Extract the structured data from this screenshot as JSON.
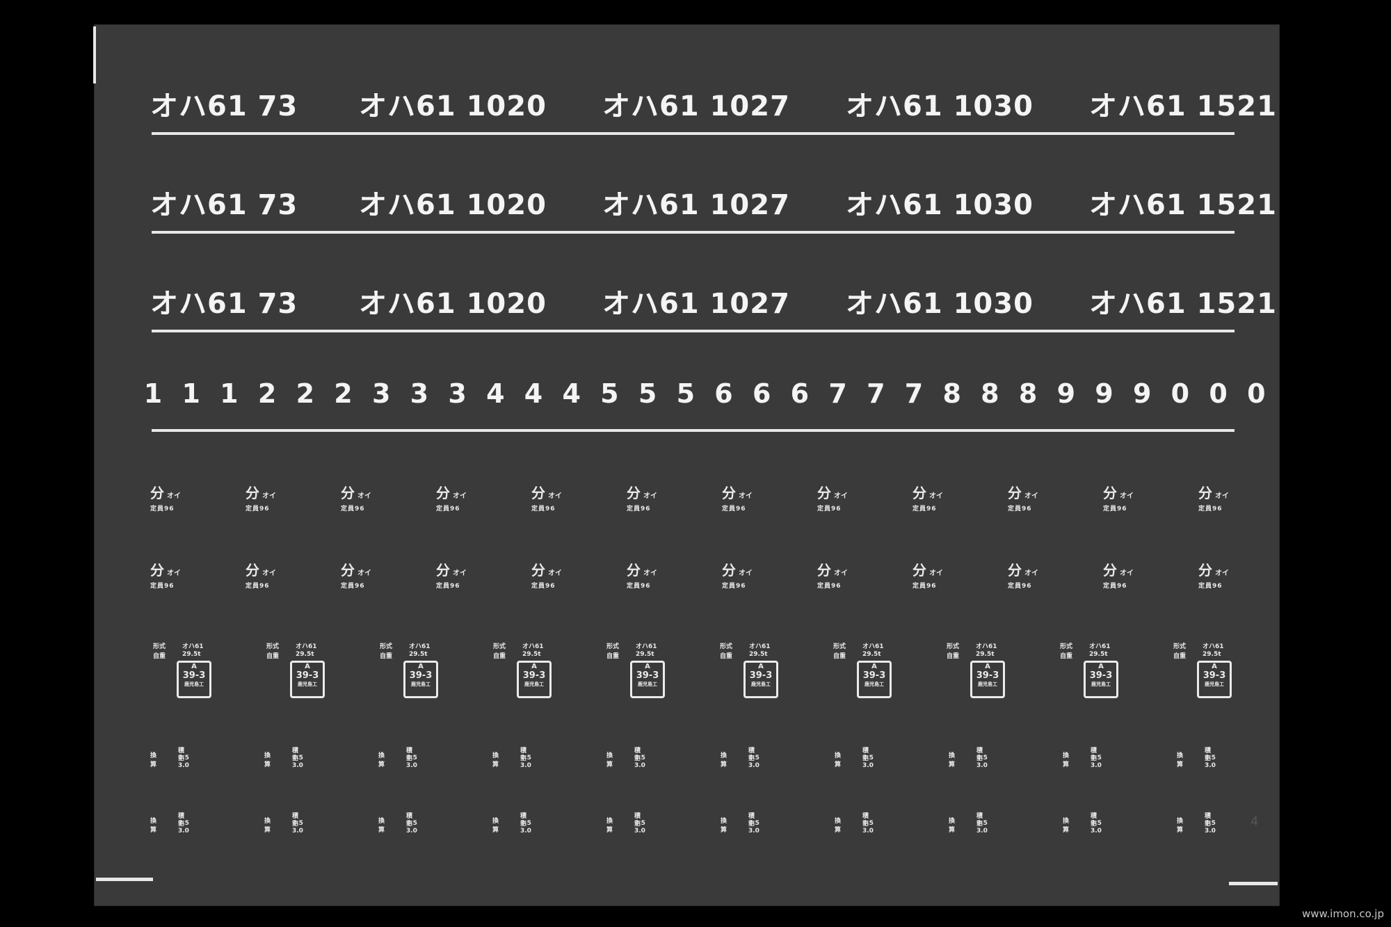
{
  "number_plates": [
    "オハ61 73",
    "オハ61 1020",
    "オハ61 1027",
    "オハ61 1030",
    "オハ61 1521"
  ],
  "digits": [
    "1",
    "1",
    "1",
    "2",
    "2",
    "2",
    "3",
    "3",
    "3",
    "4",
    "4",
    "4",
    "5",
    "5",
    "5",
    "6",
    "6",
    "6",
    "7",
    "7",
    "7",
    "8",
    "8",
    "8",
    "9",
    "9",
    "9",
    "0",
    "0",
    "0"
  ],
  "capacity_mark": {
    "kanji": "分",
    "kana": "オイ",
    "sub": "定員96"
  },
  "inspection_mark": {
    "line1_left": "形式",
    "line1_right": "オハ61",
    "line2_left": "自重",
    "line2_right": "29.5t",
    "box_top": "A",
    "box_mid": "39-3",
    "box_bottom": "鹿児島工"
  },
  "brake_mark": {
    "label": "換算",
    "value1": "積 3.5",
    "value2": "空 3.0"
  },
  "page_number": "4",
  "watermark": "www.imon.co.jp"
}
